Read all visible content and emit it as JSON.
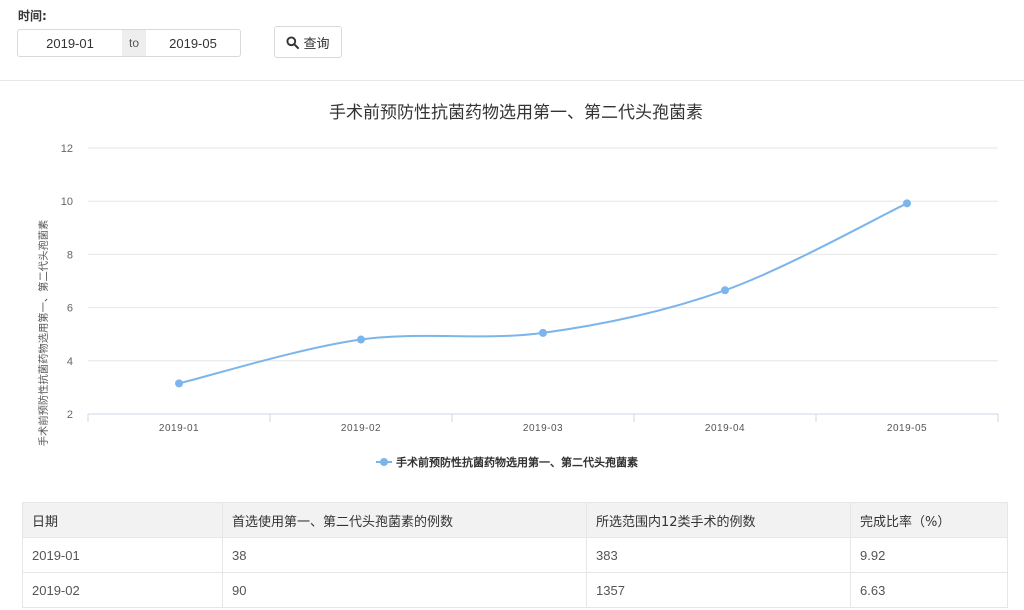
{
  "filter": {
    "time_label": "时间:",
    "from_value": "2019-01",
    "to_label": "to",
    "to_value": "2019-05",
    "query_label": "查询",
    "query_icon": "search-icon"
  },
  "chart_data": {
    "type": "line",
    "title": "手术前预防性抗菌药物选用第一、第二代头孢菌素",
    "ylabel": "手术前预防性抗菌药物选用第一、第二代头孢菌素",
    "xlabel": "",
    "categories": [
      "2019-01",
      "2019-02",
      "2019-03",
      "2019-04",
      "2019-05"
    ],
    "yticks": [
      2,
      4,
      6,
      8,
      10,
      12
    ],
    "ylim": [
      2,
      12
    ],
    "grid": true,
    "legend_position": "bottom-center",
    "series": [
      {
        "name": "手术前预防性抗菌药物选用第一、第二代头孢菌素",
        "values": [
          3.15,
          4.8,
          5.05,
          6.65,
          9.92
        ],
        "color": "#7cb5ec"
      }
    ]
  },
  "table": {
    "headers": [
      "日期",
      "首选使用第一、第二代头孢菌素的例数",
      "所选范围内12类手术的例数",
      "完成比率（%）"
    ],
    "rows": [
      [
        "2019-01",
        "38",
        "383",
        "9.92"
      ],
      [
        "2019-02",
        "90",
        "1357",
        "6.63"
      ]
    ]
  }
}
